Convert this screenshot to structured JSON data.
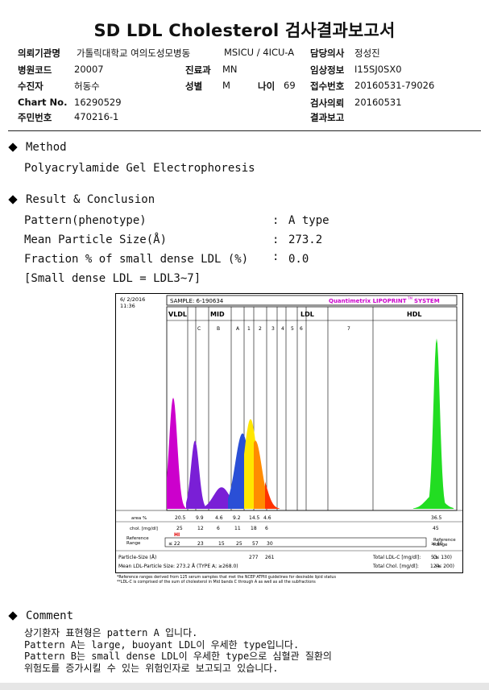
{
  "title": "SD LDL Cholesterol 검사결과보고서",
  "header": {
    "rows": [
      [
        {
          "k": "의뢰기관명",
          "v": "가톨릭대학교 여의도성모병동"
        },
        {
          "k": "",
          "v": "MSICU / 4ICU-A"
        },
        {
          "k": "담당의사",
          "v": "정성진"
        }
      ],
      [
        {
          "k": "병원코드",
          "v": "20007"
        },
        {
          "k": "진료과",
          "v": "MN"
        },
        {
          "k": "임상정보",
          "v": "I15SJ0SX0"
        }
      ],
      [
        {
          "k": "수진자",
          "v": "허동수"
        },
        {
          "k": "성별",
          "v": "M"
        },
        {
          "k": "접수번호",
          "v": "20160531-79026"
        }
      ],
      [
        {
          "k": "Chart No.",
          "v": "16290529"
        },
        {
          "k": "",
          "v": ""
        },
        {
          "k": "검사의뢰",
          "v": "20160531"
        }
      ],
      [
        {
          "k": "주민번호",
          "v": "470216-1"
        },
        {
          "k": "",
          "v": ""
        },
        {
          "k": "결과보고",
          "v": ""
        }
      ]
    ],
    "age_label": "나이",
    "age_value": "69"
  },
  "method": {
    "heading": "Method",
    "text": "Polyacrylamide Gel Electrophoresis"
  },
  "result": {
    "heading": "Result & Conclusion",
    "rows": [
      {
        "label": "Pattern(phenotype)",
        "value": "A type"
      },
      {
        "label": "Mean Particle Size(Å)",
        "value": "273.2"
      },
      {
        "label": "Fraction % of small dense LDL (%)",
        "value": "0.0"
      }
    ],
    "colon": ":",
    "note": "[Small dense LDL = LDL3~7]"
  },
  "chart": {
    "date": "6/ 2/2016",
    "time": "11:36",
    "sample": "SAMPLE:   6-190634",
    "brand": "Quantimetrix LIPOPRINT",
    "brand_tm": "TM",
    "brand_suffix": " SYSTEM",
    "group_labels": {
      "vldl": "VLDL",
      "mid": "MID",
      "ldl": "LDL",
      "hdl": "HDL"
    },
    "band_labels": [
      "C",
      "B",
      "A",
      "1",
      "2",
      "3",
      "4",
      "5",
      "6",
      "7"
    ],
    "row_labels": {
      "area": "area %",
      "chol": "chol. [mg/dl]",
      "ref": "Reference\nRange",
      "ref_right": "Reference\nRange",
      "psize": "Particle-Size (Å)",
      "mean": "Mean LDL-Particle Size:   273.2 Å   (TYPE A; ≥268.0)"
    },
    "area_values": [
      "20.5",
      "9.9",
      "4.6",
      "9.2",
      "14.5",
      "4.6",
      "36.5"
    ],
    "chol_values": [
      "25",
      "12",
      "6",
      "11",
      "18",
      "6",
      "45"
    ],
    "hi_flag": "HI",
    "ref_values": [
      "≤ 22",
      "23",
      "15",
      "25",
      "57",
      "30",
      "≥ 40"
    ],
    "psize_values": [
      "277",
      "261"
    ],
    "totals": [
      {
        "label": "Total LDL-C [mg/dl]:",
        "value": "53",
        "range": "(≤ 130)"
      },
      {
        "label": "Total Chol. [mg/dl]:",
        "value": "124",
        "range": "(≤ 200)"
      }
    ],
    "footnotes": [
      "*Reference ranges derived from 125 serum samples that met the NCEP ATPIII guidelines for desirable lipid status",
      "**LDL-C is comprised of the sum of cholesterol in Mid bands C through A as well as all the subfractions"
    ],
    "colors": {
      "vldl": "#cc00cc",
      "c_band": "#7a1fd6",
      "mid_b": "#2a4fd6",
      "ldl1": "#ffe600",
      "ldl2": "#ff8c00",
      "ldl3": "#ff3300",
      "hdl": "#22dd22"
    },
    "chart_data": {
      "type": "area",
      "x": [
        0,
        0.25,
        0.5,
        0.75,
        1.0
      ],
      "peaks": [
        {
          "name": "VLDL",
          "height": 0.62
        },
        {
          "name": "C",
          "height": 0.38
        },
        {
          "name": "A",
          "height": 0.42
        },
        {
          "name": "LDL1",
          "height": 0.5
        },
        {
          "name": "HDL",
          "height": 0.95
        }
      ]
    }
  },
  "comment": {
    "heading": "Comment",
    "lines": [
      "상기환자 표현형은 pattern A 입니다.",
      "Pattern A는 large, buoyant LDL이 우세한 type입니다.",
      "Pattern B는 small dense LDL이 우세한 type으로 심혈관 질환의",
      "위험도를 증가시킬 수 있는 위험인자로 보고되고 있습니다."
    ]
  }
}
